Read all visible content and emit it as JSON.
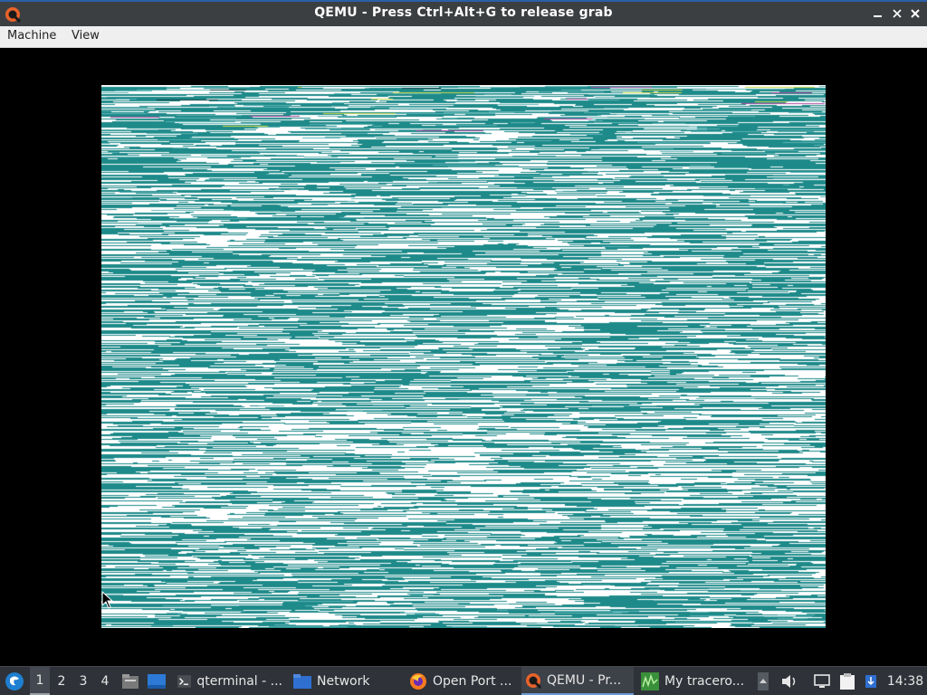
{
  "window": {
    "title": "QEMU - Press Ctrl+Alt+G to release grab",
    "app_icon": "qemu-icon",
    "controls": [
      "minimize-icon",
      "maximize-icon",
      "close-icon"
    ]
  },
  "menubar": {
    "items": [
      {
        "label": "Machine"
      },
      {
        "label": "View"
      }
    ]
  },
  "guest_display": {
    "content": "corrupted-framebuffer-noise",
    "colors": {
      "primary": "#1e8a8a",
      "secondary": "#ffffff",
      "dark": "#0a3d3d"
    }
  },
  "taskbar": {
    "start_icon": "lxqt-start-icon",
    "workspaces": [
      {
        "label": "1",
        "active": true
      },
      {
        "label": "2"
      },
      {
        "label": "3"
      },
      {
        "label": "4"
      }
    ],
    "quicklaunch": [
      "file-manager-icon",
      "show-desktop-icon"
    ],
    "tasks": [
      {
        "label": "qterminal - ...",
        "icon": "terminal-icon"
      },
      {
        "label": "Network",
        "icon": "folder-icon"
      },
      {
        "label": "Open Port ...",
        "icon": "firefox-icon"
      },
      {
        "label": "QEMU - Pr...",
        "icon": "qemu-icon",
        "active": true
      },
      {
        "label": "My tracero...",
        "icon": "mtr-icon"
      }
    ],
    "tray": [
      "scroll-arrow-icon",
      "volume-icon",
      "network-icon",
      "clipboard-icon",
      "update-icon"
    ],
    "clock": "14:38"
  }
}
